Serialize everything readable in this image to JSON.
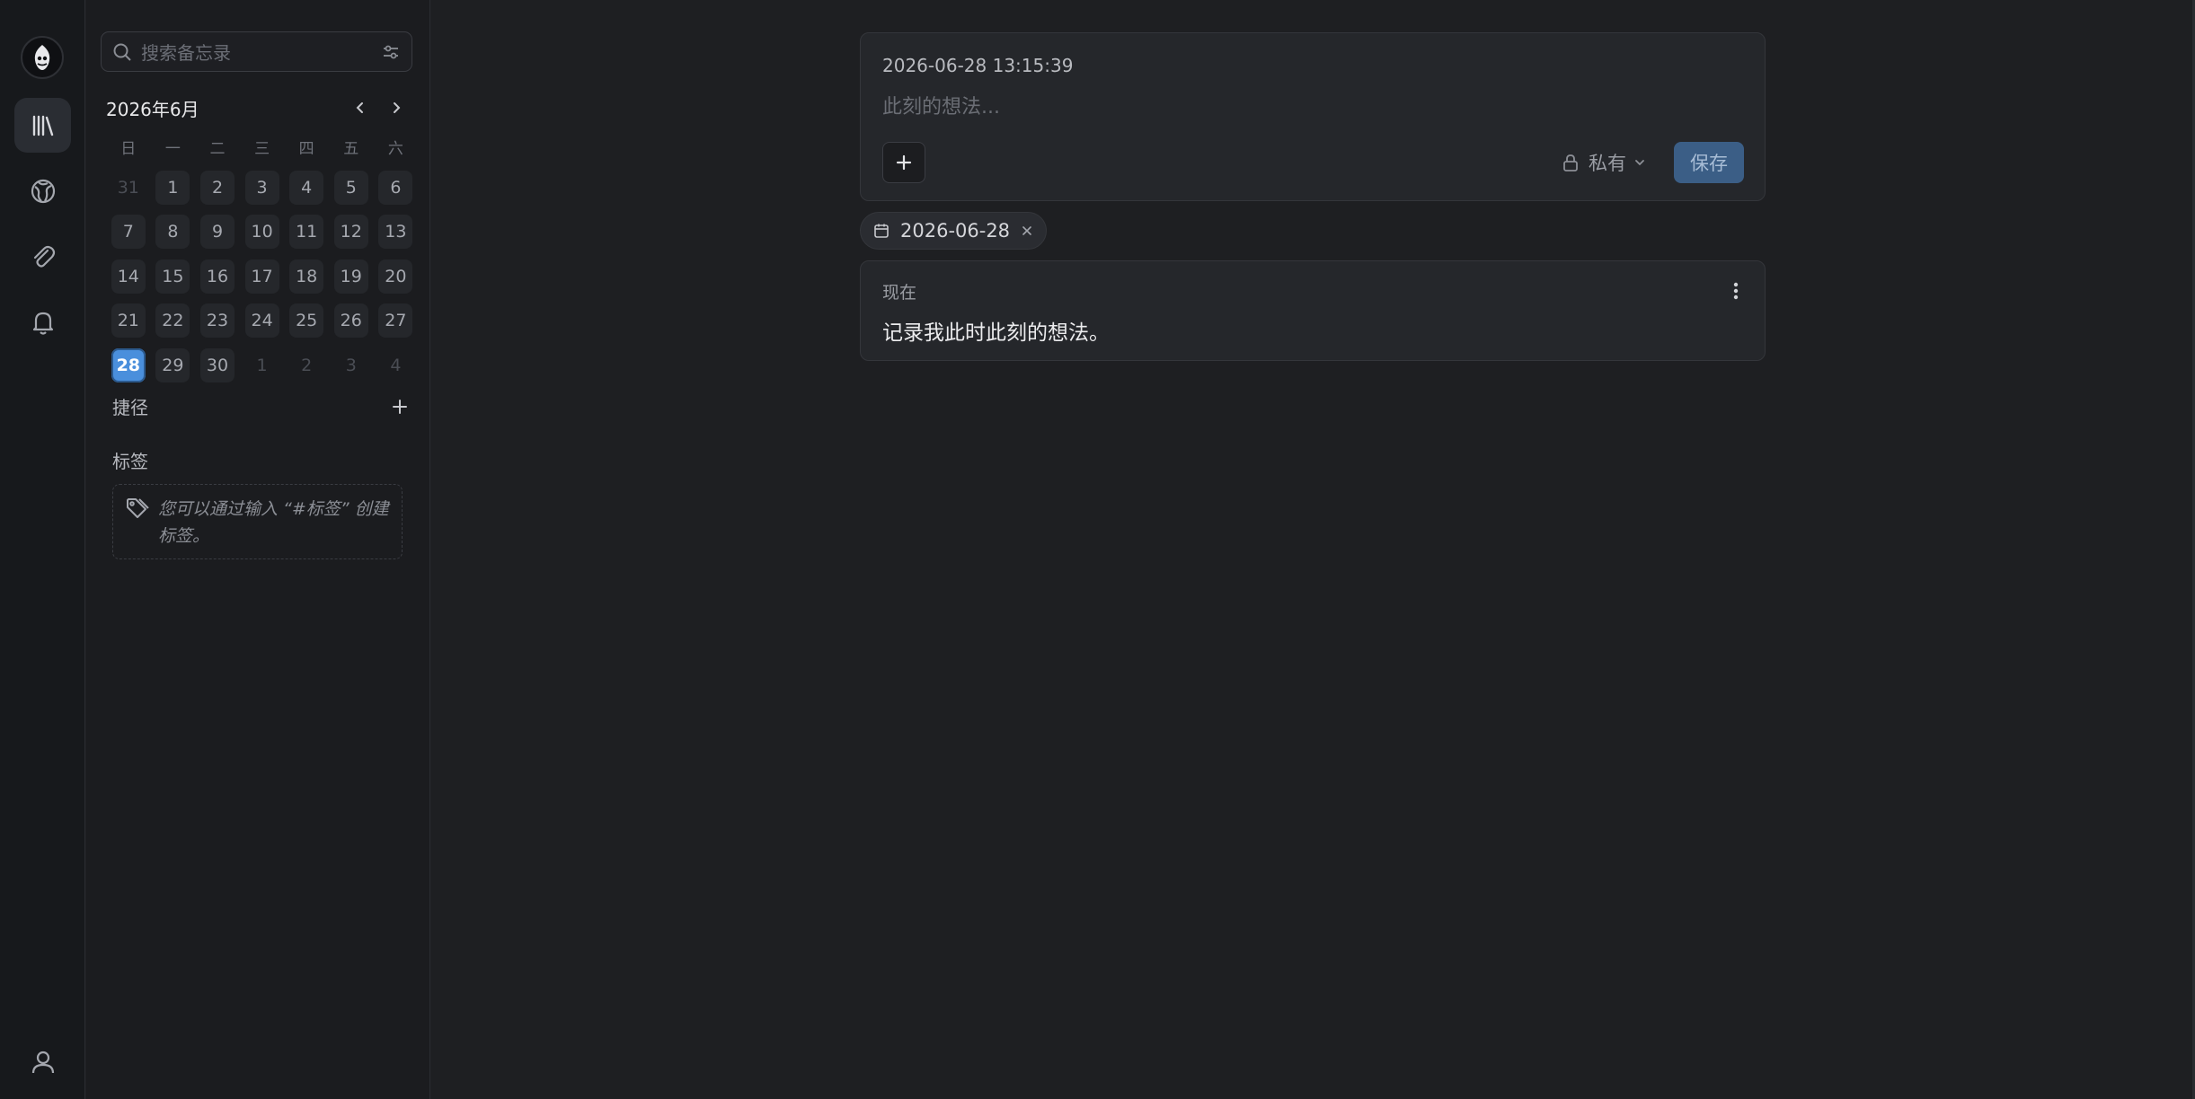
{
  "rail": {
    "logo": "app-logo",
    "items": [
      {
        "name": "memos-icon",
        "active": true
      },
      {
        "name": "explore-icon",
        "active": false
      },
      {
        "name": "attachment-icon",
        "active": false
      },
      {
        "name": "bell-icon",
        "active": false
      }
    ],
    "user": "user-icon"
  },
  "sidebar": {
    "search": {
      "placeholder": "搜索备忘录"
    },
    "calendar": {
      "title": "2026年6月",
      "weekdays": [
        "日",
        "一",
        "二",
        "三",
        "四",
        "五",
        "六"
      ],
      "days": [
        {
          "d": "31",
          "muted": true
        },
        {
          "d": "1"
        },
        {
          "d": "2"
        },
        {
          "d": "3"
        },
        {
          "d": "4"
        },
        {
          "d": "5"
        },
        {
          "d": "6"
        },
        {
          "d": "7"
        },
        {
          "d": "8"
        },
        {
          "d": "9"
        },
        {
          "d": "10"
        },
        {
          "d": "11"
        },
        {
          "d": "12"
        },
        {
          "d": "13"
        },
        {
          "d": "14"
        },
        {
          "d": "15"
        },
        {
          "d": "16"
        },
        {
          "d": "17"
        },
        {
          "d": "18"
        },
        {
          "d": "19"
        },
        {
          "d": "20"
        },
        {
          "d": "21"
        },
        {
          "d": "22"
        },
        {
          "d": "23"
        },
        {
          "d": "24"
        },
        {
          "d": "25"
        },
        {
          "d": "26"
        },
        {
          "d": "27"
        },
        {
          "d": "28",
          "today": true
        },
        {
          "d": "29"
        },
        {
          "d": "30"
        },
        {
          "d": "1",
          "muted": true
        },
        {
          "d": "2",
          "muted": true
        },
        {
          "d": "3",
          "muted": true
        },
        {
          "d": "4",
          "muted": true
        }
      ]
    },
    "shortcuts_label": "捷径",
    "tags_label": "标签",
    "tags_empty": "您可以通过输入 “#标签” 创建标签。"
  },
  "editor": {
    "timestamp": "2026-06-28 13:15:39",
    "placeholder": "此刻的想法...",
    "visibility": "私有",
    "save_label": "保存"
  },
  "filter_chip": {
    "label": "2026-06-28"
  },
  "memo": {
    "time": "现在",
    "content": "记录我此时此刻的想法。"
  },
  "colors": {
    "accent": "#4a8fdc",
    "save_button": "#3b5e86",
    "background": "#1e1f22"
  }
}
